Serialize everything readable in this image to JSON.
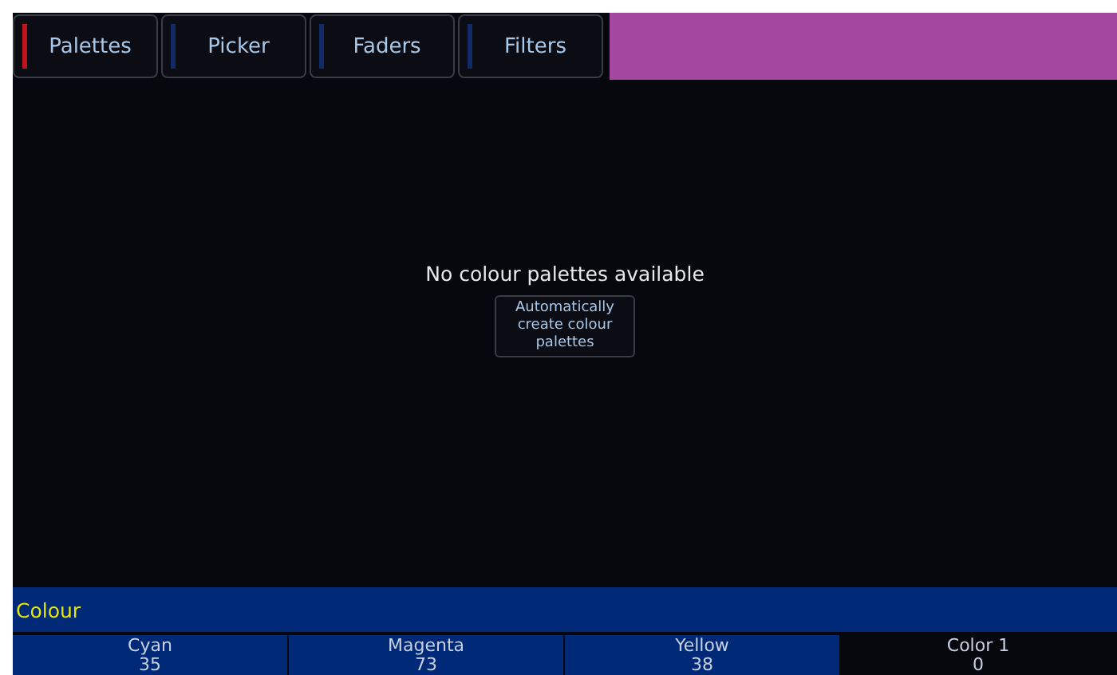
{
  "tabs": [
    {
      "label": "Palettes",
      "selected": true
    },
    {
      "label": "Picker",
      "selected": false
    },
    {
      "label": "Faders",
      "selected": false
    },
    {
      "label": "Filters",
      "selected": false
    }
  ],
  "color_preview": {
    "color": "#a4479e"
  },
  "content": {
    "message": "No colour palettes available",
    "button": "Automatically create colour palettes"
  },
  "section_title": "Colour",
  "encoders": [
    {
      "kind": "parameter",
      "name": "Cyan",
      "value": "35"
    },
    {
      "kind": "parameter",
      "name": "Magenta",
      "value": "73"
    },
    {
      "kind": "parameter",
      "name": "Yellow",
      "value": "38"
    },
    {
      "kind": "palette",
      "name": "Color 1",
      "value": "0"
    }
  ]
}
